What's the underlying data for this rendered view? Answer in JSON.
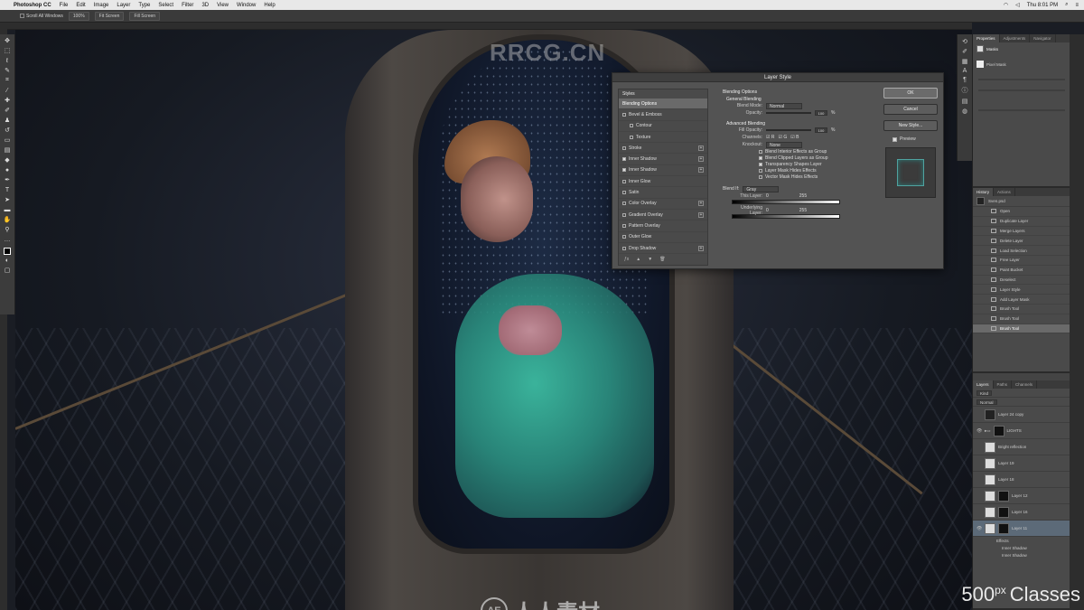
{
  "menubar": {
    "app_name": "Photoshop CC",
    "items": [
      "File",
      "Edit",
      "Image",
      "Layer",
      "Type",
      "Select",
      "Filter",
      "3D",
      "View",
      "Window",
      "Help"
    ],
    "clock": "Thu 8:01 PM"
  },
  "options_bar": {
    "scroll_all": "Scroll All Windows",
    "zoom": "100%",
    "fit_screen": "Fit Screen",
    "fill_screen": "Fill Screen"
  },
  "watermarks": {
    "top": "RRCG.CN",
    "bottom": "人人素材",
    "brand_main": "500",
    "brand_px": "px",
    "brand_classes": "Classes"
  },
  "dialog": {
    "title": "Layer Style",
    "styles_header": "Styles",
    "styles": [
      {
        "label": "Blending Options",
        "selected": true,
        "checked": null,
        "plus": false
      },
      {
        "label": "Bevel & Emboss",
        "checked": false,
        "plus": false
      },
      {
        "label": "Contour",
        "checked": false,
        "plus": false
      },
      {
        "label": "Texture",
        "checked": false,
        "plus": false
      },
      {
        "label": "Stroke",
        "checked": false,
        "plus": true
      },
      {
        "label": "Inner Shadow",
        "checked": true,
        "plus": true
      },
      {
        "label": "Inner Shadow",
        "checked": true,
        "plus": true
      },
      {
        "label": "Inner Glow",
        "checked": false,
        "plus": false
      },
      {
        "label": "Satin",
        "checked": false,
        "plus": false
      },
      {
        "label": "Color Overlay",
        "checked": false,
        "plus": true
      },
      {
        "label": "Gradient Overlay",
        "checked": false,
        "plus": true
      },
      {
        "label": "Pattern Overlay",
        "checked": false,
        "plus": false
      },
      {
        "label": "Outer Glow",
        "checked": false,
        "plus": false
      },
      {
        "label": "Drop Shadow",
        "checked": false,
        "plus": true
      }
    ],
    "blending": {
      "section": "Blending Options",
      "general": "General Blending",
      "blend_mode_label": "Blend Mode:",
      "blend_mode": "Normal",
      "opacity_label": "Opacity:",
      "opacity_value": "100",
      "advanced": "Advanced Blending",
      "fill_label": "Fill Opacity:",
      "fill_value": "100",
      "channels_label": "Channels:",
      "channels": [
        "R",
        "G",
        "B"
      ],
      "knockout_label": "Knockout:",
      "knockout": "None",
      "checks": [
        {
          "label": "Blend Interior Effects as Group",
          "on": false
        },
        {
          "label": "Blend Clipped Layers as Group",
          "on": true
        },
        {
          "label": "Transparency Shapes Layer",
          "on": true
        },
        {
          "label": "Layer Mask Hides Effects",
          "on": false
        },
        {
          "label": "Vector Mask Hides Effects",
          "on": false
        }
      ],
      "blend_if_label": "Blend If:",
      "blend_if": "Gray",
      "this_layer": "This Layer:",
      "this_layer_min": "0",
      "this_layer_max": "255",
      "underlying": "Underlying Layer:",
      "underlying_min": "0",
      "underlying_max": "255"
    },
    "buttons": {
      "ok": "OK",
      "cancel": "Cancel",
      "new_style": "New Style...",
      "preview": "Preview"
    }
  },
  "panels": {
    "properties_tabs": [
      "Properties",
      "Adjustments",
      "Navigator"
    ],
    "properties_title": "Masks",
    "properties_row": "Pixel Mask",
    "history_tabs": [
      "History",
      "Actions"
    ],
    "history_snapshot": "Sven.psd",
    "history_steps": [
      {
        "label": "Open",
        "selected": false
      },
      {
        "label": "Duplicate Layer",
        "selected": false
      },
      {
        "label": "Merge Layers",
        "selected": false
      },
      {
        "label": "Delete Layer",
        "selected": false
      },
      {
        "label": "Load Selection",
        "selected": false
      },
      {
        "label": "Free Layer",
        "selected": false
      },
      {
        "label": "Paint Bucket",
        "selected": false
      },
      {
        "label": "Deselect",
        "selected": false
      },
      {
        "label": "Layer Style",
        "selected": false
      },
      {
        "label": "Add Layer Mask",
        "selected": false
      },
      {
        "label": "Brush Tool",
        "selected": false
      },
      {
        "label": "Brush Tool",
        "selected": false
      },
      {
        "label": "Brush Tool",
        "selected": true
      }
    ],
    "layers_tabs": [
      "Layers",
      "Paths",
      "Channels"
    ],
    "layers_kind": "Kind",
    "layers_mode": "Normal",
    "layers": [
      {
        "name": "Layer 24 copy",
        "thumb": "dark",
        "mask": false,
        "selected": false
      },
      {
        "name": "LIGHTS",
        "thumb": "light",
        "mask": true,
        "selected": false
      },
      {
        "name": "Bright reflection",
        "thumb": "light",
        "mask": false,
        "selected": false
      },
      {
        "name": "Layer 19",
        "thumb": "light",
        "mask": false,
        "selected": false
      },
      {
        "name": "Layer 18",
        "thumb": "light",
        "mask": false,
        "selected": false
      },
      {
        "name": "Layer 12",
        "thumb": "light",
        "mask": true,
        "selected": false
      },
      {
        "name": "Layer 16",
        "thumb": "light",
        "mask": true,
        "selected": false
      },
      {
        "name": "Layer 11",
        "thumb": "light",
        "mask": true,
        "selected": true
      }
    ],
    "layer_effects": [
      "Effects",
      "Inner Shadow",
      "Inner Shadow"
    ]
  }
}
